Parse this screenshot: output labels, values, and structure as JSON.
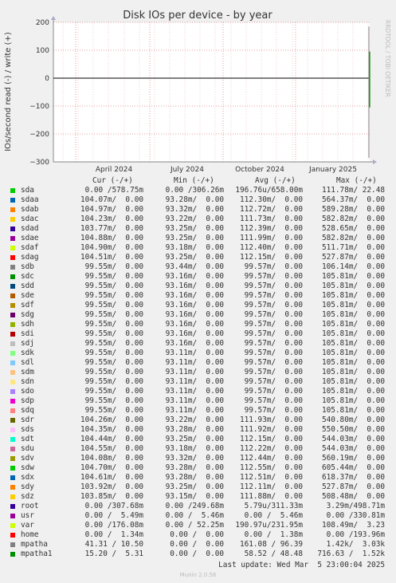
{
  "chart_data": {
    "type": "line",
    "title": "Disk IOs per device - by year",
    "ylabel": "IOs/second read (-) / write (+)",
    "ylim": [
      -300,
      200
    ],
    "yticks": [
      "200",
      "100",
      "0",
      "−100",
      "−200",
      "−300"
    ],
    "ytick_values": [
      200,
      100,
      0,
      -100,
      -200,
      -300
    ],
    "xticks": [
      "April 2024",
      "July 2024",
      "October 2024",
      "January 2025"
    ],
    "grid": true,
    "watermark": "RRDTOOL / TOBI OETIKER",
    "spike_values": {
      "write_max": 185,
      "read_min": -285
    },
    "legend_headers": {
      "cur": "Cur (-/+)",
      "min": "Min (-/+)",
      "avg": "Avg (-/+)",
      "max": "Max (-/+)"
    },
    "series": [
      {
        "name": "sda",
        "color": "#00cc00",
        "cur": "0.00 /578.75m",
        "min": "0.00 /306.26m",
        "avg": "196.76u/658.00m",
        "max": "111.78m/ 22.48"
      },
      {
        "name": "sdaa",
        "color": "#0066b3",
        "cur": "104.07m/  0.00",
        "min": "93.28m/  0.00",
        "avg": "112.30m/  0.00",
        "max": "564.37m/  0.00"
      },
      {
        "name": "sdab",
        "color": "#ff8000",
        "cur": "104.97m/  0.00",
        "min": "93.32m/  0.00",
        "avg": "112.72m/  0.00",
        "max": "589.28m/  0.00"
      },
      {
        "name": "sdac",
        "color": "#ffcc00",
        "cur": "104.23m/  0.00",
        "min": "93.22m/  0.00",
        "avg": "111.73m/  0.00",
        "max": "582.82m/  0.00"
      },
      {
        "name": "sdad",
        "color": "#330099",
        "cur": "103.77m/  0.00",
        "min": "93.25m/  0.00",
        "avg": "112.39m/  0.00",
        "max": "528.65m/  0.00"
      },
      {
        "name": "sdae",
        "color": "#990099",
        "cur": "104.88m/  0.00",
        "min": "93.25m/  0.00",
        "avg": "111.99m/  0.00",
        "max": "582.82m/  0.00"
      },
      {
        "name": "sdaf",
        "color": "#ccff00",
        "cur": "104.90m/  0.00",
        "min": "93.18m/  0.00",
        "avg": "112.40m/  0.00",
        "max": "511.71m/  0.00"
      },
      {
        "name": "sdag",
        "color": "#ff0000",
        "cur": "104.51m/  0.00",
        "min": "93.25m/  0.00",
        "avg": "112.15m/  0.00",
        "max": "527.87m/  0.00"
      },
      {
        "name": "sdb",
        "color": "#808080",
        "cur": "99.55m/  0.00",
        "min": "93.44m/  0.00",
        "avg": "99.57m/  0.00",
        "max": "106.14m/  0.00"
      },
      {
        "name": "sdc",
        "color": "#008f00",
        "cur": "99.55m/  0.00",
        "min": "93.16m/  0.00",
        "avg": "99.57m/  0.00",
        "max": "105.81m/  0.00"
      },
      {
        "name": "sdd",
        "color": "#00487d",
        "cur": "99.55m/  0.00",
        "min": "93.16m/  0.00",
        "avg": "99.57m/  0.00",
        "max": "105.81m/  0.00"
      },
      {
        "name": "sde",
        "color": "#b35a00",
        "cur": "99.55m/  0.00",
        "min": "93.16m/  0.00",
        "avg": "99.57m/  0.00",
        "max": "105.81m/  0.00"
      },
      {
        "name": "sdf",
        "color": "#b38f00",
        "cur": "99.55m/  0.00",
        "min": "93.16m/  0.00",
        "avg": "99.57m/  0.00",
        "max": "105.81m/  0.00"
      },
      {
        "name": "sdg",
        "color": "#6b006b",
        "cur": "99.55m/  0.00",
        "min": "93.16m/  0.00",
        "avg": "99.57m/  0.00",
        "max": "105.81m/  0.00"
      },
      {
        "name": "sdh",
        "color": "#8fb300",
        "cur": "99.55m/  0.00",
        "min": "93.16m/  0.00",
        "avg": "99.57m/  0.00",
        "max": "105.81m/  0.00"
      },
      {
        "name": "sdi",
        "color": "#b30000",
        "cur": "99.55m/  0.00",
        "min": "93.16m/  0.00",
        "avg": "99.57m/  0.00",
        "max": "105.81m/  0.00"
      },
      {
        "name": "sdj",
        "color": "#bebebe",
        "cur": "99.55m/  0.00",
        "min": "93.16m/  0.00",
        "avg": "99.57m/  0.00",
        "max": "105.81m/  0.00"
      },
      {
        "name": "sdk",
        "color": "#80ff80",
        "cur": "99.55m/  0.00",
        "min": "93.11m/  0.00",
        "avg": "99.57m/  0.00",
        "max": "105.81m/  0.00"
      },
      {
        "name": "sdl",
        "color": "#80c9ff",
        "cur": "99.55m/  0.00",
        "min": "93.11m/  0.00",
        "avg": "99.57m/  0.00",
        "max": "105.81m/  0.00"
      },
      {
        "name": "sdm",
        "color": "#ffc080",
        "cur": "99.55m/  0.00",
        "min": "93.11m/  0.00",
        "avg": "99.57m/  0.00",
        "max": "105.81m/  0.00"
      },
      {
        "name": "sdn",
        "color": "#ffe680",
        "cur": "99.55m/  0.00",
        "min": "93.11m/  0.00",
        "avg": "99.57m/  0.00",
        "max": "105.81m/  0.00"
      },
      {
        "name": "sdo",
        "color": "#aa80ff",
        "cur": "99.55m/  0.00",
        "min": "93.11m/  0.00",
        "avg": "99.57m/  0.00",
        "max": "105.81m/  0.00"
      },
      {
        "name": "sdp",
        "color": "#ee00cc",
        "cur": "99.55m/  0.00",
        "min": "93.11m/  0.00",
        "avg": "99.57m/  0.00",
        "max": "105.81m/  0.00"
      },
      {
        "name": "sdq",
        "color": "#ff8080",
        "cur": "99.55m/  0.00",
        "min": "93.11m/  0.00",
        "avg": "99.57m/  0.00",
        "max": "105.81m/  0.00"
      },
      {
        "name": "sdr",
        "color": "#666600",
        "cur": "104.26m/  0.00",
        "min": "93.22m/  0.00",
        "avg": "111.93m/  0.00",
        "max": "540.80m/  0.00"
      },
      {
        "name": "sds",
        "color": "#ffbfff",
        "cur": "104.35m/  0.00",
        "min": "93.28m/  0.00",
        "avg": "111.92m/  0.00",
        "max": "550.50m/  0.00"
      },
      {
        "name": "sdt",
        "color": "#00ffcc",
        "cur": "104.44m/  0.00",
        "min": "93.25m/  0.00",
        "avg": "112.15m/  0.00",
        "max": "544.03m/  0.00"
      },
      {
        "name": "sdu",
        "color": "#cc6699",
        "cur": "104.55m/  0.00",
        "min": "93.18m/  0.00",
        "avg": "112.22m/  0.00",
        "max": "544.03m/  0.00"
      },
      {
        "name": "sdv",
        "color": "#999900",
        "cur": "104.08m/  0.00",
        "min": "93.32m/  0.00",
        "avg": "112.44m/  0.00",
        "max": "560.19m/  0.00"
      },
      {
        "name": "sdw",
        "color": "#00cc00",
        "cur": "104.70m/  0.00",
        "min": "93.28m/  0.00",
        "avg": "112.55m/  0.00",
        "max": "605.44m/  0.00"
      },
      {
        "name": "sdx",
        "color": "#0066b3",
        "cur": "104.61m/  0.00",
        "min": "93.28m/  0.00",
        "avg": "112.51m/  0.00",
        "max": "618.37m/  0.00"
      },
      {
        "name": "sdy",
        "color": "#ff8000",
        "cur": "103.92m/  0.00",
        "min": "93.25m/  0.00",
        "avg": "112.11m/  0.00",
        "max": "527.87m/  0.00"
      },
      {
        "name": "sdz",
        "color": "#ffcc00",
        "cur": "103.85m/  0.00",
        "min": "93.15m/  0.00",
        "avg": "111.88m/  0.00",
        "max": "508.48m/  0.00"
      },
      {
        "name": "root",
        "color": "#330099",
        "cur": "0.00 /307.68m",
        "min": "0.00 /249.68m",
        "avg": "5.79u/311.33m",
        "max": "3.29m/498.71m"
      },
      {
        "name": "usr",
        "color": "#990099",
        "cur": "0.00 /  5.49m",
        "min": "0.00 /  5.46m",
        "avg": "0.00 /  5.46m",
        "max": "0.00 /330.81m"
      },
      {
        "name": "var",
        "color": "#ccff00",
        "cur": "0.00 /176.08m",
        "min": "0.00 / 52.25m",
        "avg": "190.97u/231.95m",
        "max": "108.49m/  3.23"
      },
      {
        "name": "home",
        "color": "#ff0000",
        "cur": "0.00 /  1.34m",
        "min": "0.00 /  0.00",
        "avg": "0.00 /  1.38m",
        "max": "0.00 /193.96m"
      },
      {
        "name": "mpatha",
        "color": "#808080",
        "cur": "41.31 / 10.50",
        "min": "0.00 /  0.00",
        "avg": "161.08 / 96.39",
        "max": "1.42k/  3.03k"
      },
      {
        "name": "mpatha1",
        "color": "#008f00",
        "cur": "15.20 /  5.31",
        "min": "0.00 /  0.00",
        "avg": "58.52 / 48.48",
        "max": "716.63 /  1.52k"
      }
    ]
  },
  "footer": {
    "last_update": "Last update: Wed Mar  5 23:00:04 2025",
    "munin_version": "Munin 2.0.56"
  }
}
